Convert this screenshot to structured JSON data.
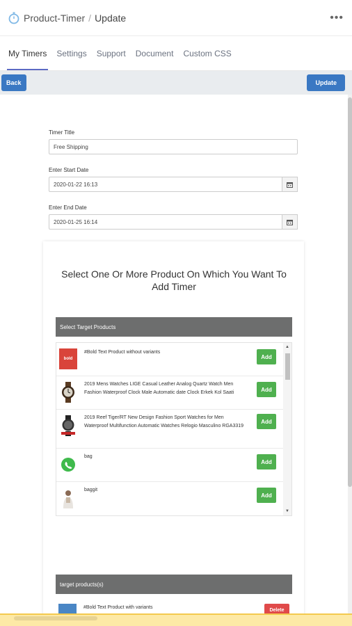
{
  "header": {
    "app_name": "Product-Timer",
    "separator": "/",
    "page": "Update",
    "more": "•••"
  },
  "tabs": [
    {
      "label": "My Timers",
      "active": true
    },
    {
      "label": "Settings",
      "active": false
    },
    {
      "label": "Support",
      "active": false
    },
    {
      "label": "Document",
      "active": false
    },
    {
      "label": "Custom CSS",
      "active": false
    }
  ],
  "toolbar": {
    "back_label": "Back",
    "update_label": "Update"
  },
  "form": {
    "title_label": "Timer Title",
    "title_value": "Free Shipping",
    "start_label": "Enter Start Date",
    "start_value": "2020-01-22 16:13",
    "end_label": "Enter End Date",
    "end_value": "2020-01-25 16:14"
  },
  "products_panel": {
    "heading": "Select One Or More Product On Which You Want To Add Timer",
    "select_bar": "Select Target Products",
    "items": [
      {
        "name": "#Bold Text Product without variants",
        "action": "Add",
        "thumb_text": "bold",
        "icon": "bold-product-icon"
      },
      {
        "name": "2019 Mens Watches LIGE Casual Leather Analog Quartz Watch Men Fashion Waterproof Clock Male Automatic date Clock Erkek Kol Saati",
        "action": "Add",
        "icon": "watch-icon"
      },
      {
        "name": "2019 Reef Tiger/RT New Design Fashion Sport Watches for Men Waterproof Multifunction Automatic Watches Relogio Masculino RGA3319",
        "action": "Add",
        "icon": "sport-watch-icon"
      },
      {
        "name": "bag",
        "action": "Add",
        "icon": "whatsapp-icon"
      },
      {
        "name": "baggit",
        "action": "Add",
        "icon": "person-icon"
      }
    ],
    "target_bar": "target products(s)",
    "target_items": [
      {
        "name": "#Bold Text Product with variants",
        "action": "Delete"
      }
    ]
  },
  "colors": {
    "primary_blue": "#3a78c3",
    "add_green": "#4fb04f",
    "delete_red": "#e04a4a",
    "section_gray": "#6d6e6e",
    "tab_underline": "#5c6ac4"
  }
}
